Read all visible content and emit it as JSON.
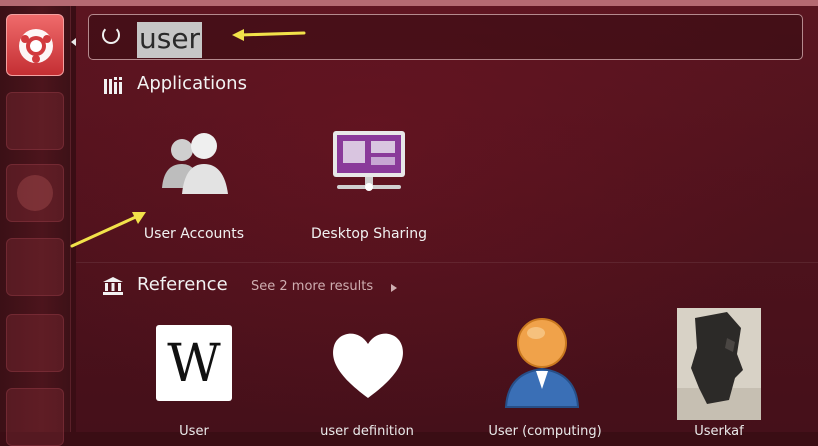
{
  "search": {
    "query": "user"
  },
  "sections": {
    "applications": {
      "title": "Applications",
      "items": [
        {
          "label": "User Accounts",
          "icon": "users-icon"
        },
        {
          "label": "Desktop Sharing",
          "icon": "desktop-sharing-icon"
        }
      ]
    },
    "reference": {
      "title": "Reference",
      "more": "See 2 more results",
      "items": [
        {
          "label": "User",
          "icon": "wikipedia-icon"
        },
        {
          "label": "user definition",
          "icon": "heart-icon"
        },
        {
          "label": "User (computing)",
          "icon": "user-avatar-icon"
        },
        {
          "label": "Userkaf",
          "icon": "statue-image"
        }
      ]
    }
  },
  "colors": {
    "accent": "#c42f33",
    "background": "#4e121c",
    "annotation_arrow": "#f2e24a"
  }
}
